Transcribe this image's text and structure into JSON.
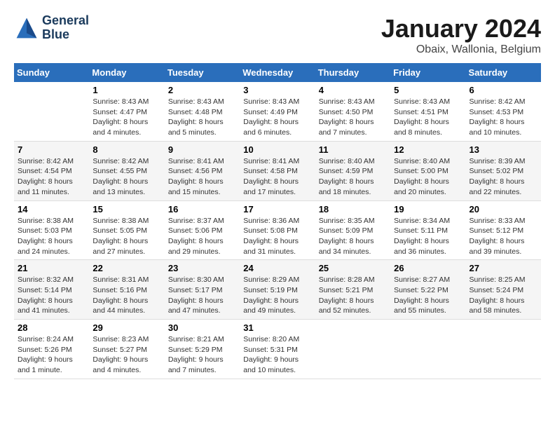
{
  "header": {
    "logo_line1": "General",
    "logo_line2": "Blue",
    "month": "January 2024",
    "location": "Obaix, Wallonia, Belgium"
  },
  "days_of_week": [
    "Sunday",
    "Monday",
    "Tuesday",
    "Wednesday",
    "Thursday",
    "Friday",
    "Saturday"
  ],
  "weeks": [
    [
      {
        "num": "",
        "sunrise": "",
        "sunset": "",
        "daylight": ""
      },
      {
        "num": "1",
        "sunrise": "Sunrise: 8:43 AM",
        "sunset": "Sunset: 4:47 PM",
        "daylight": "Daylight: 8 hours and 4 minutes."
      },
      {
        "num": "2",
        "sunrise": "Sunrise: 8:43 AM",
        "sunset": "Sunset: 4:48 PM",
        "daylight": "Daylight: 8 hours and 5 minutes."
      },
      {
        "num": "3",
        "sunrise": "Sunrise: 8:43 AM",
        "sunset": "Sunset: 4:49 PM",
        "daylight": "Daylight: 8 hours and 6 minutes."
      },
      {
        "num": "4",
        "sunrise": "Sunrise: 8:43 AM",
        "sunset": "Sunset: 4:50 PM",
        "daylight": "Daylight: 8 hours and 7 minutes."
      },
      {
        "num": "5",
        "sunrise": "Sunrise: 8:43 AM",
        "sunset": "Sunset: 4:51 PM",
        "daylight": "Daylight: 8 hours and 8 minutes."
      },
      {
        "num": "6",
        "sunrise": "Sunrise: 8:42 AM",
        "sunset": "Sunset: 4:53 PM",
        "daylight": "Daylight: 8 hours and 10 minutes."
      }
    ],
    [
      {
        "num": "7",
        "sunrise": "Sunrise: 8:42 AM",
        "sunset": "Sunset: 4:54 PM",
        "daylight": "Daylight: 8 hours and 11 minutes."
      },
      {
        "num": "8",
        "sunrise": "Sunrise: 8:42 AM",
        "sunset": "Sunset: 4:55 PM",
        "daylight": "Daylight: 8 hours and 13 minutes."
      },
      {
        "num": "9",
        "sunrise": "Sunrise: 8:41 AM",
        "sunset": "Sunset: 4:56 PM",
        "daylight": "Daylight: 8 hours and 15 minutes."
      },
      {
        "num": "10",
        "sunrise": "Sunrise: 8:41 AM",
        "sunset": "Sunset: 4:58 PM",
        "daylight": "Daylight: 8 hours and 17 minutes."
      },
      {
        "num": "11",
        "sunrise": "Sunrise: 8:40 AM",
        "sunset": "Sunset: 4:59 PM",
        "daylight": "Daylight: 8 hours and 18 minutes."
      },
      {
        "num": "12",
        "sunrise": "Sunrise: 8:40 AM",
        "sunset": "Sunset: 5:00 PM",
        "daylight": "Daylight: 8 hours and 20 minutes."
      },
      {
        "num": "13",
        "sunrise": "Sunrise: 8:39 AM",
        "sunset": "Sunset: 5:02 PM",
        "daylight": "Daylight: 8 hours and 22 minutes."
      }
    ],
    [
      {
        "num": "14",
        "sunrise": "Sunrise: 8:38 AM",
        "sunset": "Sunset: 5:03 PM",
        "daylight": "Daylight: 8 hours and 24 minutes."
      },
      {
        "num": "15",
        "sunrise": "Sunrise: 8:38 AM",
        "sunset": "Sunset: 5:05 PM",
        "daylight": "Daylight: 8 hours and 27 minutes."
      },
      {
        "num": "16",
        "sunrise": "Sunrise: 8:37 AM",
        "sunset": "Sunset: 5:06 PM",
        "daylight": "Daylight: 8 hours and 29 minutes."
      },
      {
        "num": "17",
        "sunrise": "Sunrise: 8:36 AM",
        "sunset": "Sunset: 5:08 PM",
        "daylight": "Daylight: 8 hours and 31 minutes."
      },
      {
        "num": "18",
        "sunrise": "Sunrise: 8:35 AM",
        "sunset": "Sunset: 5:09 PM",
        "daylight": "Daylight: 8 hours and 34 minutes."
      },
      {
        "num": "19",
        "sunrise": "Sunrise: 8:34 AM",
        "sunset": "Sunset: 5:11 PM",
        "daylight": "Daylight: 8 hours and 36 minutes."
      },
      {
        "num": "20",
        "sunrise": "Sunrise: 8:33 AM",
        "sunset": "Sunset: 5:12 PM",
        "daylight": "Daylight: 8 hours and 39 minutes."
      }
    ],
    [
      {
        "num": "21",
        "sunrise": "Sunrise: 8:32 AM",
        "sunset": "Sunset: 5:14 PM",
        "daylight": "Daylight: 8 hours and 41 minutes."
      },
      {
        "num": "22",
        "sunrise": "Sunrise: 8:31 AM",
        "sunset": "Sunset: 5:16 PM",
        "daylight": "Daylight: 8 hours and 44 minutes."
      },
      {
        "num": "23",
        "sunrise": "Sunrise: 8:30 AM",
        "sunset": "Sunset: 5:17 PM",
        "daylight": "Daylight: 8 hours and 47 minutes."
      },
      {
        "num": "24",
        "sunrise": "Sunrise: 8:29 AM",
        "sunset": "Sunset: 5:19 PM",
        "daylight": "Daylight: 8 hours and 49 minutes."
      },
      {
        "num": "25",
        "sunrise": "Sunrise: 8:28 AM",
        "sunset": "Sunset: 5:21 PM",
        "daylight": "Daylight: 8 hours and 52 minutes."
      },
      {
        "num": "26",
        "sunrise": "Sunrise: 8:27 AM",
        "sunset": "Sunset: 5:22 PM",
        "daylight": "Daylight: 8 hours and 55 minutes."
      },
      {
        "num": "27",
        "sunrise": "Sunrise: 8:25 AM",
        "sunset": "Sunset: 5:24 PM",
        "daylight": "Daylight: 8 hours and 58 minutes."
      }
    ],
    [
      {
        "num": "28",
        "sunrise": "Sunrise: 8:24 AM",
        "sunset": "Sunset: 5:26 PM",
        "daylight": "Daylight: 9 hours and 1 minute."
      },
      {
        "num": "29",
        "sunrise": "Sunrise: 8:23 AM",
        "sunset": "Sunset: 5:27 PM",
        "daylight": "Daylight: 9 hours and 4 minutes."
      },
      {
        "num": "30",
        "sunrise": "Sunrise: 8:21 AM",
        "sunset": "Sunset: 5:29 PM",
        "daylight": "Daylight: 9 hours and 7 minutes."
      },
      {
        "num": "31",
        "sunrise": "Sunrise: 8:20 AM",
        "sunset": "Sunset: 5:31 PM",
        "daylight": "Daylight: 9 hours and 10 minutes."
      },
      {
        "num": "",
        "sunrise": "",
        "sunset": "",
        "daylight": ""
      },
      {
        "num": "",
        "sunrise": "",
        "sunset": "",
        "daylight": ""
      },
      {
        "num": "",
        "sunrise": "",
        "sunset": "",
        "daylight": ""
      }
    ]
  ]
}
